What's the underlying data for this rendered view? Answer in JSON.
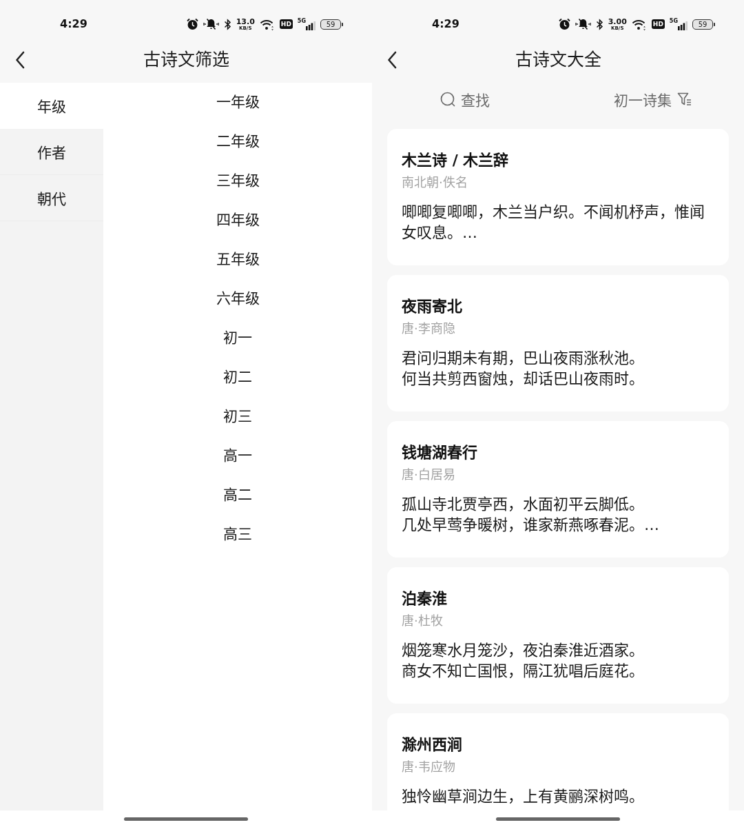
{
  "filter_screen": {
    "status_bar": {
      "time": "4:29",
      "speed_value": "13.0",
      "speed_unit": "KB/S",
      "hd_badge": "HD",
      "network_type": "5G",
      "battery": "59"
    },
    "title": "古诗文筛选",
    "categories": [
      {
        "label": "年级",
        "selected": true
      },
      {
        "label": "作者",
        "selected": false
      },
      {
        "label": "朝代",
        "selected": false
      }
    ],
    "options": [
      "一年级",
      "二年级",
      "三年级",
      "四年级",
      "五年级",
      "六年级",
      "初一",
      "初二",
      "初三",
      "高一",
      "高二",
      "高三"
    ]
  },
  "list_screen": {
    "status_bar": {
      "time": "4:29",
      "speed_value": "3.00",
      "speed_unit": "KB/S",
      "hd_badge": "HD",
      "network_type": "5G",
      "battery": "59"
    },
    "title": "古诗文大全",
    "toolbar": {
      "search_label": "查找",
      "collection_label": "初一诗集"
    },
    "poems": [
      {
        "title": "木兰诗 / 木兰辞",
        "source": "南北朝·佚名",
        "lines": [
          "唧唧复唧唧，木兰当户织。不闻机杼声，惟闻女叹息。…"
        ]
      },
      {
        "title": "夜雨寄北",
        "source": "唐·李商隐",
        "lines": [
          "君问归期未有期，巴山夜雨涨秋池。",
          "何当共剪西窗烛，却话巴山夜雨时。"
        ]
      },
      {
        "title": "钱塘湖春行",
        "source": "唐·白居易",
        "lines": [
          "孤山寺北贾亭西，水面初平云脚低。",
          "几处早莺争暖树，谁家新燕啄春泥。…"
        ]
      },
      {
        "title": "泊秦淮",
        "source": "唐·杜牧",
        "lines": [
          "烟笼寒水月笼沙，夜泊秦淮近酒家。",
          "商女不知亡国恨，隔江犹唱后庭花。"
        ]
      },
      {
        "title": "滁州西涧",
        "source": "唐·韦应物",
        "lines": [
          "独怜幽草涧边生，上有黄鹂深树鸣。"
        ]
      }
    ]
  }
}
